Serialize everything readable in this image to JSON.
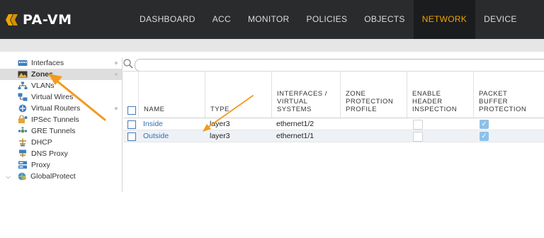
{
  "app": {
    "title": "PA-VM"
  },
  "nav": {
    "items": [
      {
        "label": "DASHBOARD"
      },
      {
        "label": "ACC"
      },
      {
        "label": "MONITOR"
      },
      {
        "label": "POLICIES"
      },
      {
        "label": "OBJECTS"
      },
      {
        "label": "NETWORK",
        "active": true
      },
      {
        "label": "DEVICE"
      }
    ]
  },
  "sidebar": {
    "items": [
      {
        "label": "Interfaces",
        "icon": "interfaces-icon"
      },
      {
        "label": "Zones",
        "icon": "zones-icon",
        "selected": true
      },
      {
        "label": "VLANs",
        "icon": "vlans-icon"
      },
      {
        "label": "Virtual Wires",
        "icon": "virtual-wires-icon"
      },
      {
        "label": "Virtual Routers",
        "icon": "virtual-routers-icon"
      },
      {
        "label": "IPSec Tunnels",
        "icon": "ipsec-tunnels-icon"
      },
      {
        "label": "GRE Tunnels",
        "icon": "gre-tunnels-icon"
      },
      {
        "label": "DHCP",
        "icon": "dhcp-icon"
      },
      {
        "label": "DNS Proxy",
        "icon": "dns-proxy-icon"
      },
      {
        "label": "Proxy",
        "icon": "proxy-icon"
      },
      {
        "label": "GlobalProtect",
        "icon": "globalprotect-icon",
        "expandable": true
      }
    ]
  },
  "search": {
    "placeholder": ""
  },
  "table": {
    "columns": [
      {
        "label": "NAME"
      },
      {
        "label": "TYPE"
      },
      {
        "label": "INTERFACES / VIRTUAL SYSTEMS"
      },
      {
        "label": "ZONE PROTECTION PROFILE"
      },
      {
        "label": "ENABLE HEADER INSPECTION"
      },
      {
        "label": "PACKET BUFFER PROTECTION"
      }
    ],
    "rows": [
      {
        "name": "Inside",
        "type": "layer3",
        "interfaces": "ethernet1/2",
        "zone_protection_profile": "",
        "enable_header_inspection": false,
        "packet_buffer_protection": true
      },
      {
        "name": "Outside",
        "type": "layer3",
        "interfaces": "ethernet1/1",
        "zone_protection_profile": "",
        "enable_header_inspection": false,
        "packet_buffer_protection": true
      }
    ]
  },
  "colors": {
    "topbar": "#2a2b2d",
    "accent": "#f0a500",
    "link": "#2f6fb3",
    "annotation_arrow": "#f29a1f",
    "checked_box": "#8cc1e8"
  }
}
